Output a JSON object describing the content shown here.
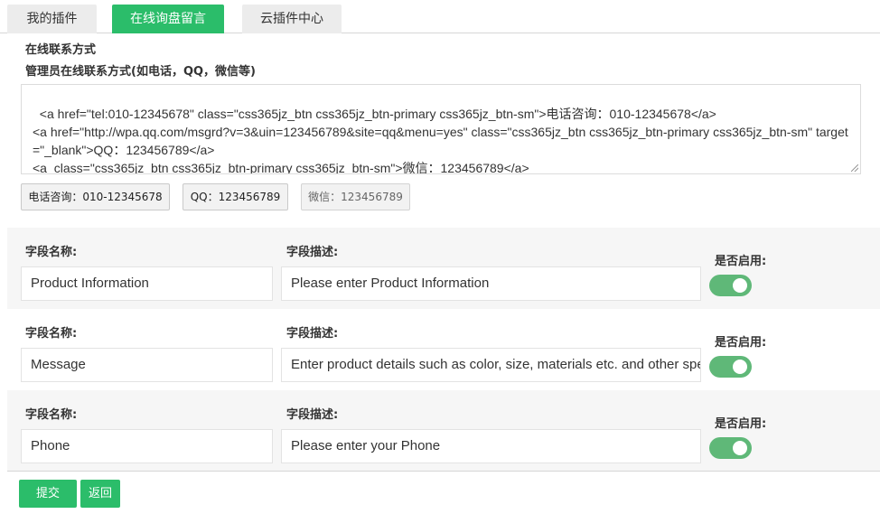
{
  "tabs": [
    {
      "label": "我的插件",
      "active": false
    },
    {
      "label": "在线询盘留言",
      "active": true
    },
    {
      "label": "云插件中心",
      "active": false
    }
  ],
  "contact": {
    "section_title": "在线联系方式",
    "subtitle": "管理员在线联系方式(如电话，QQ，微信等)",
    "code": "<a href=\"tel:010-12345678\" class=\"css365jz_btn css365jz_btn-primary css365jz_btn-sm\">电话咨询：010-12345678</a>\n<a href=\"http://wpa.qq.com/msgrd?v=3&uin=123456789&site=qq&menu=yes\" class=\"css365jz_btn css365jz_btn-primary css365jz_btn-sm\" target=\"_blank\">QQ：123456789</a>\n<a  class=\"css365jz_btn css365jz_btn-primary css365jz_btn-sm\">微信：123456789</a>",
    "preview_buttons": [
      "电话咨询：010-12345678",
      "QQ：123456789",
      "微信：123456789"
    ]
  },
  "fields": [
    {
      "name_label": "字段名称:",
      "desc_label": "字段描述:",
      "enable_label": "是否启用:",
      "name": "Product Information",
      "desc": "Please enter Product Information",
      "enabled": true
    },
    {
      "name_label": "字段名称:",
      "desc_label": "字段描述:",
      "enable_label": "是否启用:",
      "name": "Message",
      "desc": "Enter product details such as color, size, materials etc. and other specific requirements",
      "enabled": true
    },
    {
      "name_label": "字段名称:",
      "desc_label": "字段描述:",
      "enable_label": "是否启用:",
      "name": "Phone",
      "desc": "Please enter your Phone",
      "enabled": true
    }
  ],
  "actions": {
    "submit": "提交",
    "back": "返回"
  },
  "colors": {
    "accent": "#2bbd6a",
    "toggle_on": "#5fb878"
  }
}
